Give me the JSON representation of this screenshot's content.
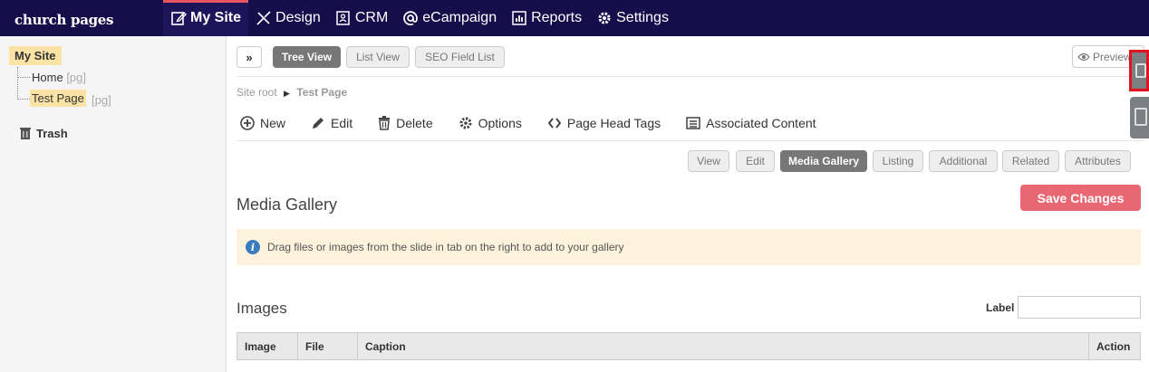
{
  "brand": {
    "logo_text": "church pages"
  },
  "nav": {
    "items": [
      {
        "label": "My Site",
        "icon": "edit-page-icon"
      },
      {
        "label": "Design",
        "icon": "brush-icon"
      },
      {
        "label": "CRM",
        "icon": "contacts-icon"
      },
      {
        "label": "eCampaign",
        "icon": "at-icon"
      },
      {
        "label": "Reports",
        "icon": "bar-chart-icon"
      },
      {
        "label": "Settings",
        "icon": "gear-icon"
      }
    ]
  },
  "sidebar": {
    "root": "My Site",
    "pages": [
      {
        "label": "Home",
        "type": "[pg]"
      },
      {
        "label": "Test Page",
        "type": "[pg]"
      }
    ],
    "trash": "Trash"
  },
  "view_buttons": {
    "tree": "Tree View",
    "list": "List View",
    "seo": "SEO Field List",
    "preview": "Preview",
    "expand": "»"
  },
  "breadcrumb": {
    "root": "Site root",
    "current": "Test Page"
  },
  "actions": [
    {
      "label": "New",
      "icon": "plus-circle-icon"
    },
    {
      "label": "Edit",
      "icon": "pencil-icon"
    },
    {
      "label": "Delete",
      "icon": "trash-icon"
    },
    {
      "label": "Options",
      "icon": "gear-icon"
    },
    {
      "label": "Page Head Tags",
      "icon": "code-icon"
    },
    {
      "label": "Associated Content",
      "icon": "list-icon"
    }
  ],
  "tabs": [
    "View",
    "Edit",
    "Media Gallery",
    "Listing",
    "Additional",
    "Related",
    "Attributes"
  ],
  "active_tab": "Media Gallery",
  "content": {
    "title": "Media Gallery",
    "save_label": "Save Changes",
    "info_text": "Drag files or images from the slide in tab on the right to add to your gallery",
    "images_title": "Images",
    "label_text": "Label",
    "label_value": ""
  },
  "table": {
    "columns": [
      "Image",
      "File",
      "Caption",
      "Action"
    ]
  },
  "colors": {
    "topbar": "#160e4b",
    "accent": "#e96773",
    "highlight": "#fbe3a6"
  }
}
